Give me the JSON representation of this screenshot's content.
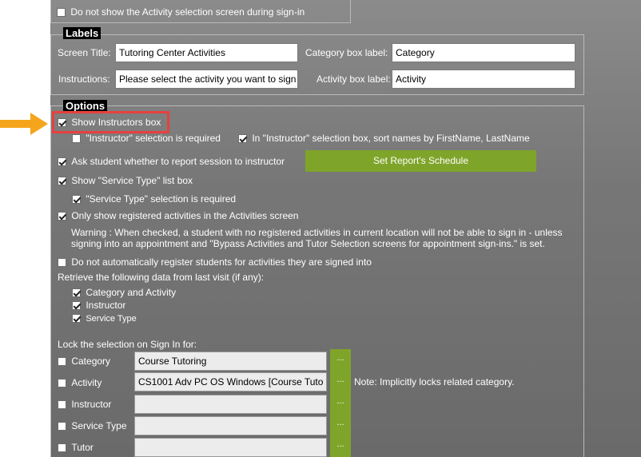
{
  "top_option": {
    "label": "Do not show the Activity selection screen during sign-in",
    "checked": false
  },
  "labels_section": {
    "legend": "Labels",
    "screen_title_label": "Screen Title:",
    "screen_title_value": "Tutoring Center Activities",
    "instructions_label": "Instructions:",
    "instructions_value": "Please select the activity you want to sign",
    "category_box_label": "Category box label:",
    "category_box_value": "Category",
    "activity_box_label": "Activity box label:",
    "activity_box_value": "Activity"
  },
  "options_section": {
    "legend": "Options",
    "show_instructors": {
      "label": "Show Instructors box",
      "checked": true
    },
    "instructor_required": {
      "label": "\"Instructor\" selection is required",
      "checked": false
    },
    "instructor_sort": {
      "label": "In \"Instructor\" selection box, sort names by FirstName, LastName",
      "checked": true
    },
    "ask_report": {
      "label": "Ask student whether to report session to instructor",
      "checked": true
    },
    "set_schedule_button": "Set Report's Schedule",
    "show_service_type": {
      "label": "Show \"Service Type\" list box",
      "checked": true
    },
    "service_type_required": {
      "label": "\"Service Type\" selection is required",
      "checked": true
    },
    "only_registered": {
      "label": "Only show registered activities in the Activities screen",
      "checked": true
    },
    "warning_line1": "Warning : When checked, a student with no registered activities in current location will not be able to sign in - unless",
    "warning_line2": "signing into an appointment and \"Bypass Activities and Tutor Selection screens for appointment sign-ins.\" is set.",
    "no_auto_register": {
      "label": "Do not automatically register students for activities they are signed into",
      "checked": false
    },
    "retrieve_label": "Retrieve the following data from last visit (if any):",
    "retrieve_category_activity": {
      "label": "Category and Activity",
      "checked": true
    },
    "retrieve_instructor": {
      "label": "Instructor",
      "checked": true
    },
    "retrieve_service_type": {
      "label": "Service Type",
      "checked": true
    },
    "lock_label": "Lock the selection on Sign In for:",
    "lock_rows": [
      {
        "label": "Category",
        "value": "Course Tutoring",
        "checked": false
      },
      {
        "label": "Activity",
        "value": "CS1001 Adv PC OS Windows [Course Tuto",
        "checked": false
      },
      {
        "label": "Instructor",
        "value": "",
        "checked": false
      },
      {
        "label": "Service Type",
        "value": "",
        "checked": false
      },
      {
        "label": "Tutor",
        "value": "",
        "checked": false
      }
    ],
    "ellipsis": "...",
    "activity_note": "Note: Implicitly locks related category."
  },
  "colors": {
    "accent_green": "#7fa42a",
    "highlight_red": "#e8403f",
    "arrow_orange": "#f4a51c"
  }
}
